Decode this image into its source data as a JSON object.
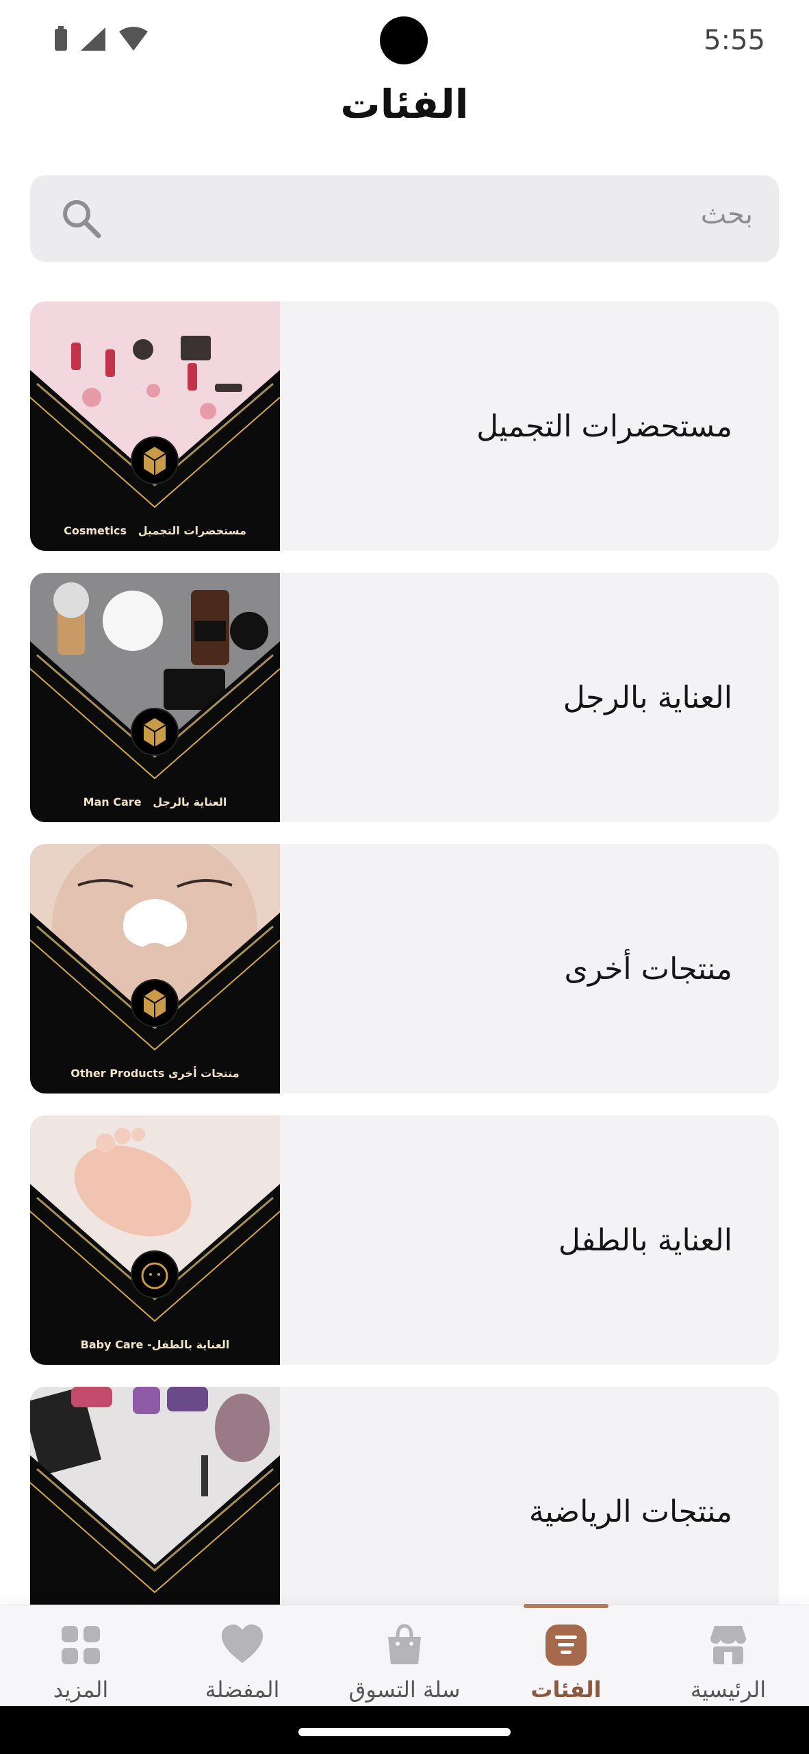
{
  "status_bar": {
    "time": "5:55"
  },
  "title": "الفئات",
  "search": {
    "placeholder": "بحث"
  },
  "categories": [
    {
      "name": "مستحضرات التجميل",
      "thumb_en": "Cosmetics",
      "thumb_ar": "مستحضرات التجميل",
      "badge_icon": "box-icon",
      "photo_bg": "#f3d7de"
    },
    {
      "name": "العناية بالرجل",
      "thumb_en": "Man Care",
      "thumb_ar": "العناية بالرجل",
      "badge_icon": "box-icon",
      "photo_bg": "#8a8a8c"
    },
    {
      "name": "منتجات أخرى",
      "thumb_en": "Other Products",
      "thumb_ar": "منتجات أخرى",
      "badge_icon": "box-icon",
      "photo_bg": "#e9d3c6"
    },
    {
      "name": "العناية بالطفل",
      "thumb_en": "Baby Care",
      "thumb_ar": "-العناية بالطفل",
      "badge_icon": "baby-icon",
      "photo_bg": "#efe6e1"
    },
    {
      "name": "منتجات الرياضية",
      "thumb_en": "",
      "thumb_ar": "",
      "badge_icon": "",
      "photo_bg": "#e4e2e3"
    }
  ],
  "bottom_nav": {
    "items": [
      {
        "label": "المزيد",
        "icon": "grid-icon",
        "active": false
      },
      {
        "label": "المفضلة",
        "icon": "heart-icon",
        "active": false
      },
      {
        "label": "سلة التسوق",
        "icon": "shopping-bag-icon",
        "active": false
      },
      {
        "label": "الفئات",
        "icon": "categories-icon",
        "active": true
      },
      {
        "label": "الرئيسية",
        "icon": "store-icon",
        "active": false
      }
    ]
  },
  "colors": {
    "accent": "#8b5a3e",
    "accent_light": "#b07d5e",
    "card_bg": "#f3f2f4",
    "search_bg": "#ececee",
    "gold": "#d4a94e"
  }
}
